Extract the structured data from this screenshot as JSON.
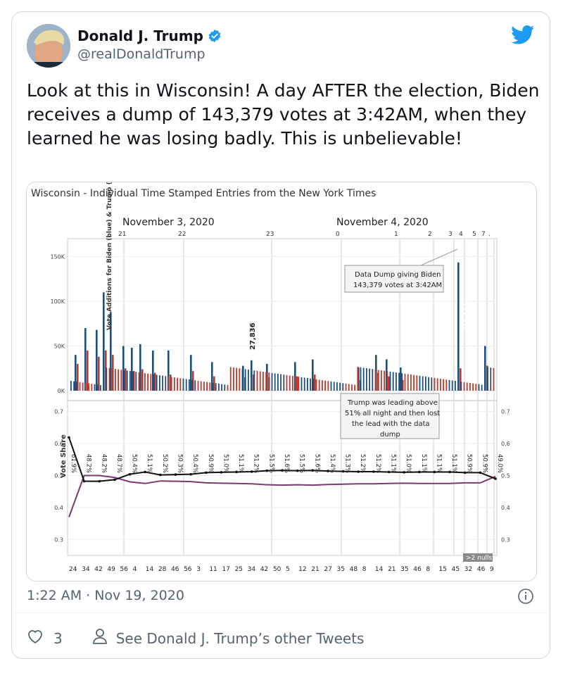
{
  "tweet": {
    "author_name": "Donald J. Trump",
    "handle": "@realDonaldTrump",
    "text": "Look at this in Wisconsin! A day AFTER the election, Biden receives a dump of 143,379 votes at 3:42AM, when they learned he was losing badly. This is unbelievable!",
    "timestamp": "1:22 AM · Nov 19, 2020",
    "like_count": "3",
    "other_tweets_label": "See Donald J. Trump’s other Tweets",
    "colors": {
      "verified": "#1d9bf0",
      "brand": "#1d9bf0",
      "muted": "#536471"
    }
  },
  "media": {
    "title": "Wisconsin - Individual Time Stamped Entries from the New York Times",
    "date_labels": [
      "November 3, 2020",
      "November 4, 2020"
    ],
    "top_hour_labels": [
      "21",
      "22",
      "23",
      "0",
      "1",
      "2",
      "3",
      "4",
      "5",
      "7",
      "."
    ],
    "annotation_dump": "Data Dump giving Biden 143,379 votes at 3:42AM",
    "annotation_lead": "Trump was leading above 51% all night and then lost the lead with the data dump",
    "label_27836": "27,836",
    "label_143379": "143,379",
    "nulls_badge": ">2 nulls",
    "minute_labels": [
      "24",
      "34",
      "42",
      "49",
      "56",
      "4",
      "14",
      "28",
      "46",
      "56",
      "3",
      "11",
      "17",
      "25",
      "34",
      "42",
      "50",
      "5",
      "12",
      "21",
      "27",
      "35",
      "48",
      "8",
      "14",
      "21",
      "35",
      "46",
      "8",
      "15",
      "45",
      "32",
      "46",
      "9"
    ],
    "share_labels": [
      "61.9%",
      "48.2%",
      "48.2%",
      "48.7%",
      "50.4%",
      "51.1%",
      "50.2%",
      "50.3%",
      "50.4%",
      "50.9%",
      "51.0%",
      "51.1%",
      "51.2%",
      "51.5%",
      "51.6%",
      "51.5%",
      "51.6%",
      "51.4%",
      "51.3%",
      "51.2%",
      "51.2%",
      "51.1%",
      "51.0%",
      "51.1%",
      "51.1%",
      "51.1%",
      "50.9%",
      "50.9%",
      "49.0%"
    ],
    "colors": {
      "biden": "#1f4e79",
      "trump": "#c0392b",
      "share_trump": "#111111",
      "share_biden": "#7a3b6e"
    }
  },
  "chart_data": [
    {
      "type": "bar",
      "title": "",
      "ylabel": "Vote Additions for Biden (blue) & Trump (red)",
      "ylim": [
        0,
        170000
      ],
      "yticks": [
        "0K",
        "50K",
        "100K",
        "150K"
      ],
      "series": [
        {
          "name": "Biden",
          "values": [
            40000,
            70000,
            68000,
            110000,
            88000,
            50000,
            48000,
            52000,
            45000,
            45000,
            40000,
            32000,
            27836,
            34000,
            30000,
            32000,
            35000,
            26000,
            40000,
            35000,
            26000,
            143379,
            50000
          ]
        },
        {
          "name": "Trump",
          "values": [
            30000,
            45000,
            38000,
            45000,
            40000,
            25000,
            22000,
            24000,
            20000,
            18000,
            22000,
            16000,
            15000,
            18000,
            15000,
            16000,
            18000,
            12000,
            20000,
            16000,
            12000,
            25000,
            28000
          ]
        }
      ]
    },
    {
      "type": "line",
      "title": "",
      "ylabel": "Vote Share",
      "ylim": [
        0.25,
        0.73
      ],
      "yticks": [
        "0.3",
        "0.4",
        "0.5",
        "0.6",
        "0.7"
      ],
      "series": [
        {
          "name": "Trump",
          "values": [
            0.619,
            0.482,
            0.482,
            0.487,
            0.504,
            0.511,
            0.502,
            0.503,
            0.504,
            0.509,
            0.51,
            0.511,
            0.512,
            0.515,
            0.516,
            0.515,
            0.516,
            0.514,
            0.513,
            0.512,
            0.512,
            0.511,
            0.51,
            0.511,
            0.511,
            0.511,
            0.509,
            0.509,
            0.49
          ]
        },
        {
          "name": "Biden",
          "values": [
            0.37,
            0.5,
            0.5,
            0.494,
            0.48,
            0.475,
            0.483,
            0.482,
            0.481,
            0.477,
            0.476,
            0.475,
            0.474,
            0.471,
            0.47,
            0.471,
            0.47,
            0.472,
            0.473,
            0.474,
            0.474,
            0.475,
            0.476,
            0.475,
            0.475,
            0.475,
            0.477,
            0.477,
            0.497
          ]
        }
      ]
    }
  ]
}
